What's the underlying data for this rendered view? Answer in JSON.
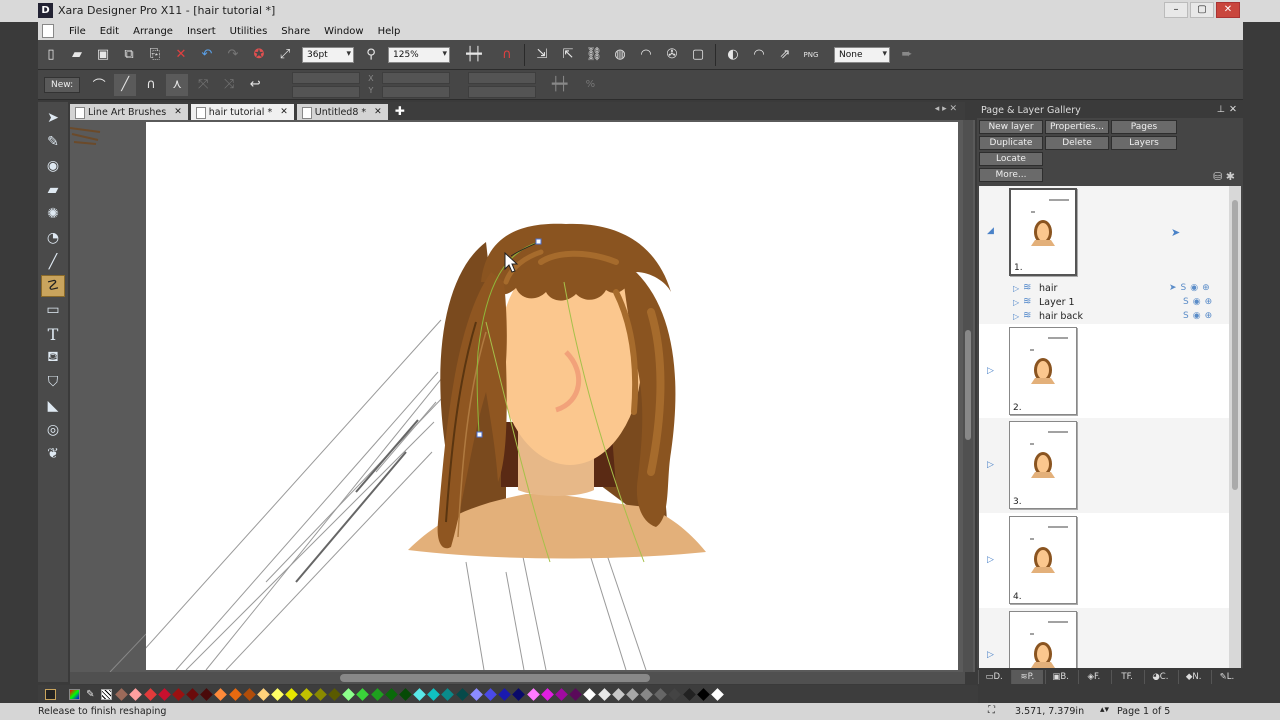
{
  "window": {
    "app_letter": "D",
    "title": "Xara Designer Pro X11 - [hair tutorial *]",
    "controls": {
      "minimize": "–",
      "maximize": "▢",
      "close": "✕"
    }
  },
  "menu": [
    "File",
    "Edit",
    "Arrange",
    "Insert",
    "Utilities",
    "Share",
    "Window",
    "Help"
  ],
  "toolbar1": {
    "font_size": "36pt",
    "zoom": "125%",
    "none_label": "None",
    "png_label": "PNG"
  },
  "toolbar2": {
    "new_label": "New:",
    "x_label": "X",
    "y_label": "Y",
    "percent_label": "%"
  },
  "tools": [
    {
      "name": "selector-tool",
      "glyph": "➤"
    },
    {
      "name": "contour-tool",
      "glyph": "✎"
    },
    {
      "name": "photo-tool",
      "glyph": "◉"
    },
    {
      "name": "eraser-tool",
      "glyph": "▰"
    },
    {
      "name": "fill-tool",
      "glyph": "✺"
    },
    {
      "name": "transparency-tool",
      "glyph": "◔"
    },
    {
      "name": "pen-tool",
      "glyph": "╱"
    },
    {
      "name": "shape-editor-tool",
      "glyph": "☡",
      "active": true
    },
    {
      "name": "rectangle-tool",
      "glyph": "▭"
    },
    {
      "name": "text-tool",
      "glyph": "T"
    },
    {
      "name": "fill-bucket-tool",
      "glyph": "⛾"
    },
    {
      "name": "mould-tool",
      "glyph": "⛉"
    },
    {
      "name": "shadow-tool",
      "glyph": "◣"
    },
    {
      "name": "bevel-tool",
      "glyph": "◎"
    },
    {
      "name": "blend-tool",
      "glyph": "❦"
    }
  ],
  "doc_tabs": [
    {
      "label": "Line Art Brushes",
      "active": false
    },
    {
      "label": "hair tutorial *",
      "active": true
    },
    {
      "label": "Untitled8 *",
      "active": false
    }
  ],
  "gallery": {
    "title": "Page & Layer Gallery",
    "buttons": {
      "new_layer": "New layer",
      "properties": "Properties...",
      "pages": "Pages",
      "duplicate": "Duplicate",
      "delete": "Delete",
      "layers": "Layers",
      "locate": "Locate",
      "more": "More..."
    },
    "pages": [
      "1.",
      "2.",
      "3.",
      "4.",
      ""
    ],
    "layers": [
      {
        "name": "hair"
      },
      {
        "name": "Layer 1"
      },
      {
        "name": "hair back"
      }
    ],
    "layer_flags": {
      "s": "S",
      "eye": "◉",
      "lock": "⊕"
    },
    "tabs": [
      "D.",
      "P.",
      "B.",
      "F.",
      "F.",
      "C.",
      "N.",
      "L."
    ]
  },
  "palette": {
    "colors": [
      "#9c6a5a",
      "#ff9f9f",
      "#e23b3b",
      "#c8102e",
      "#9b1111",
      "#6b0b0b",
      "#4a0a0a",
      "#ff8a3a",
      "#e86a10",
      "#b14d0a",
      "#ffd27a",
      "#ffff66",
      "#e6e600",
      "#c0c000",
      "#8a8a00",
      "#5a5a00",
      "#8cff8c",
      "#3ad43a",
      "#1ea01e",
      "#0a6a0a",
      "#064a06",
      "#5ae8e8",
      "#10c0c0",
      "#0a8a8a",
      "#064a4a",
      "#8c8cff",
      "#4a4ae8",
      "#1a1ab0",
      "#0a0a6a",
      "#ff7aff",
      "#e21ee2",
      "#a00aa0",
      "#5a0a5a",
      "#ffffff",
      "#e8e8e8",
      "#c8c8c8",
      "#a8a8a8",
      "#888888",
      "#666666",
      "#444444",
      "#222222",
      "#000000",
      "#ffffff"
    ]
  },
  "status": {
    "message": "Release to finish reshaping",
    "coords": "3.571, 7.379in",
    "page": "Page 1 of 5"
  }
}
